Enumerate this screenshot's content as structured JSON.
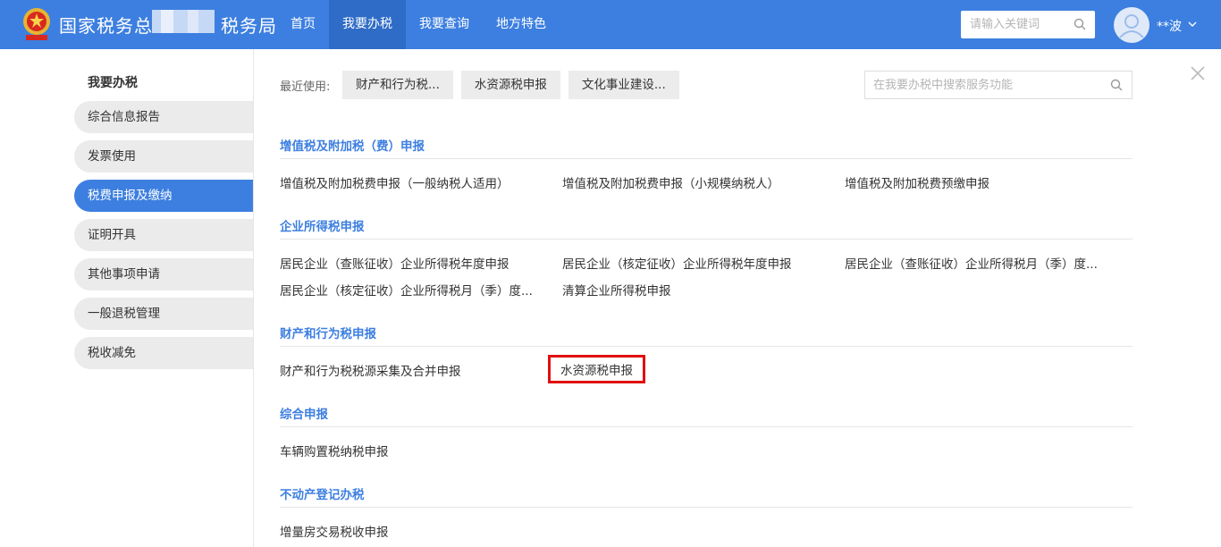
{
  "header": {
    "logo_text": "国家税务总",
    "logo_text_suffix": "税务局",
    "nav": [
      {
        "label": "首页",
        "active": false
      },
      {
        "label": "我要办税",
        "active": true
      },
      {
        "label": "我要查询",
        "active": false
      },
      {
        "label": "地方特色",
        "active": false
      }
    ],
    "search_placeholder": "请输入关键词",
    "search_icon": "search-icon",
    "user_name": "**波",
    "user_icon": "avatar-icon",
    "user_menu_icon": "chevron-down-icon"
  },
  "sidebar": {
    "title": "我要办税",
    "items": [
      {
        "label": "综合信息报告",
        "active": false
      },
      {
        "label": "发票使用",
        "active": false
      },
      {
        "label": "税费申报及缴纳",
        "active": true
      },
      {
        "label": "证明开具",
        "active": false
      },
      {
        "label": "其他事项申请",
        "active": false
      },
      {
        "label": "一般退税管理",
        "active": false
      },
      {
        "label": "税收减免",
        "active": false
      }
    ]
  },
  "main": {
    "recent_label": "最近使用:",
    "recent": [
      "财产和行为税...",
      "水资源税申报",
      "文化事业建设..."
    ],
    "search_placeholder": "在我要办税中搜索服务功能",
    "close_icon": "close-icon",
    "sections": [
      {
        "title": "增值税及附加税（费）申报",
        "items": [
          "增值税及附加税费申报（一般纳税人适用）",
          "增值税及附加税费申报（小规模纳税人）",
          "增值税及附加税费预缴申报"
        ]
      },
      {
        "title": "企业所得税申报",
        "items": [
          "居民企业（查账征收）企业所得税年度申报",
          "居民企业（核定征收）企业所得税年度申报",
          "居民企业（查账征收）企业所得税月（季）度...",
          "居民企业（核定征收）企业所得税月（季）度...",
          "清算企业所得税申报"
        ]
      },
      {
        "title": "财产和行为税申报",
        "items": [
          "财产和行为税税源采集及合并申报",
          "水资源税申报"
        ]
      },
      {
        "title": "综合申报",
        "items": [
          "车辆购置税纳税申报"
        ]
      },
      {
        "title": "不动产登记办税",
        "items": [
          "增量房交易税收申报"
        ]
      }
    ]
  },
  "colors": {
    "header_bg": "#3d7fe0",
    "nav_active_bg": "#2f6cc7",
    "section_title": "#3d7fe0",
    "highlight_border": "#e01010"
  }
}
